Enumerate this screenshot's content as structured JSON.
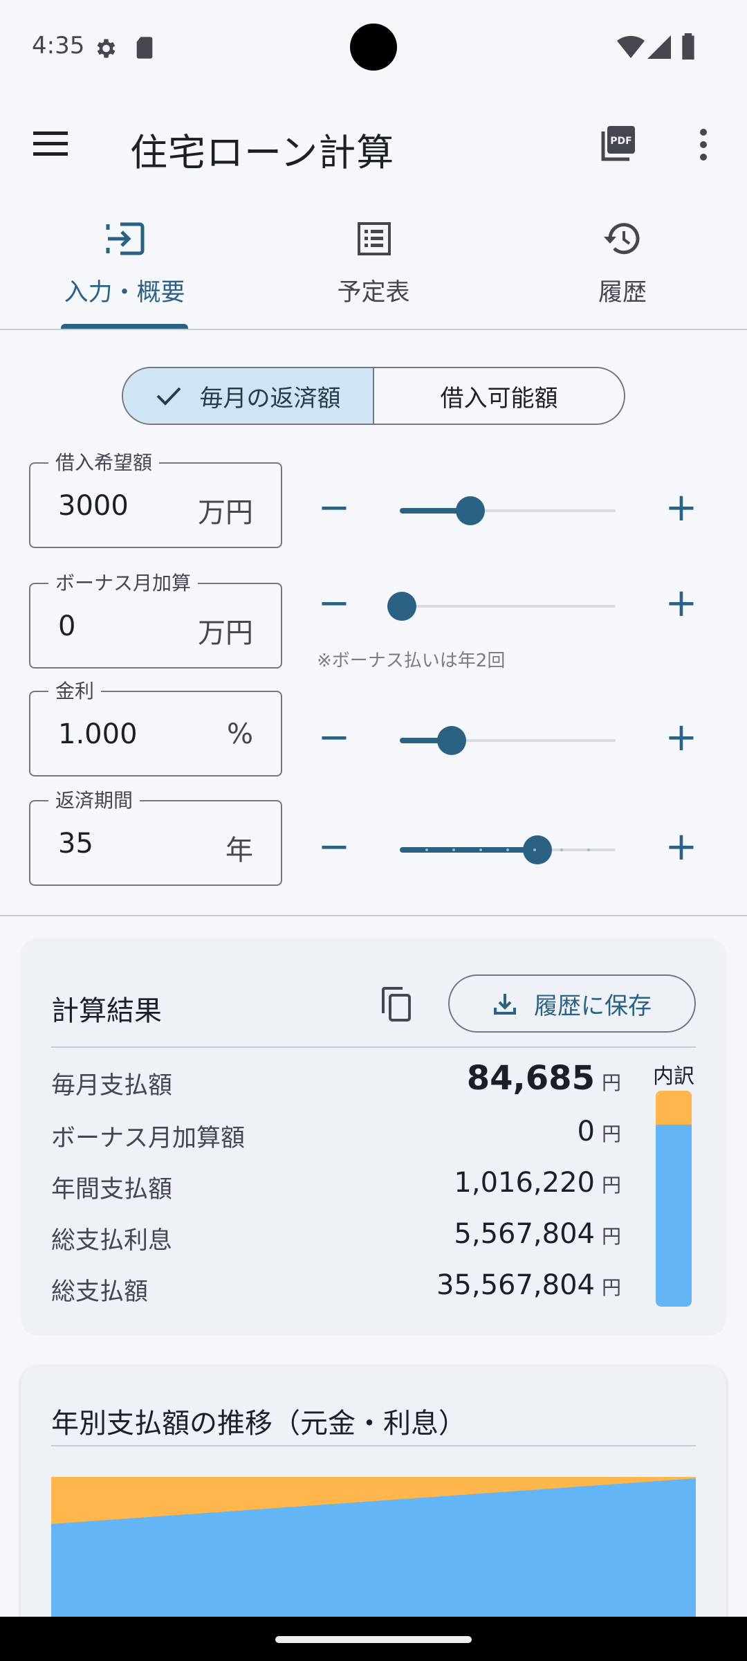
{
  "status_bar": {
    "time": "4:35"
  },
  "app_bar": {
    "title": "住宅ローン計算"
  },
  "tabs": [
    {
      "label": "入力・概要",
      "icon": "input-icon",
      "active": true
    },
    {
      "label": "予定表",
      "icon": "list-icon",
      "active": false
    },
    {
      "label": "履歴",
      "icon": "history-icon",
      "active": false
    }
  ],
  "mode_toggle": {
    "monthly_label": "毎月の返済額",
    "borrowable_label": "借入可能額",
    "selected": "monthly"
  },
  "inputs": {
    "loan_amount": {
      "label": "借入希望額",
      "value": "3000",
      "unit": "万円",
      "slider_fraction": 0.3
    },
    "bonus_add": {
      "label": "ボーナス月加算",
      "value": "0",
      "unit": "万円",
      "slider_fraction": 0.0,
      "hint": "※ボーナス払いは年2回"
    },
    "interest_rate": {
      "label": "金利",
      "value": "1.000",
      "unit": "%",
      "slider_fraction": 0.2
    },
    "term": {
      "label": "返済期間",
      "value": "35",
      "unit": "年",
      "slider_fraction": 0.66
    }
  },
  "result": {
    "title": "計算結果",
    "save_label": "履歴に保存",
    "yen": "円",
    "breakdown_label": "内訳",
    "rows": [
      {
        "label": "毎月支払額",
        "value": "84,685"
      },
      {
        "label": "ボーナス月加算額",
        "value": "0"
      },
      {
        "label": "年間支払額",
        "value": "1,016,220"
      },
      {
        "label": "総支払利息",
        "value": "5,567,804"
      },
      {
        "label": "総支払額",
        "value": "35,567,804"
      }
    ],
    "breakdown": {
      "principal": 30000000,
      "interest": 5567804,
      "principal_color": "#64b5f6",
      "interest_color": "#ffb74d"
    }
  },
  "chart": {
    "title": "年別支払額の推移（元金・利息）"
  },
  "chart_data": {
    "type": "area",
    "x": [
      1,
      35
    ],
    "series": [
      {
        "values": [
          0.67,
          0.99
        ],
        "color": "#64b5f6"
      },
      {
        "values": [
          0.33,
          0.01
        ],
        "color": "#ffb74d"
      }
    ],
    "stacked": true
  },
  "colors": {
    "accent": "#2b6283",
    "selected_segment": "#cfe5f5"
  }
}
